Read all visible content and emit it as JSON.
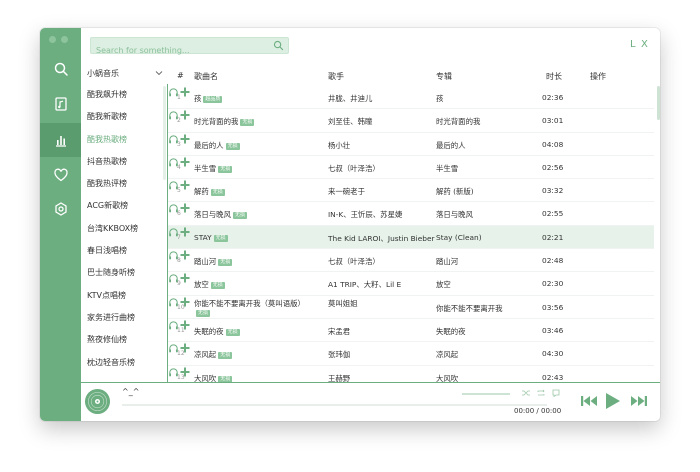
{
  "search": {
    "placeholder": "Search for something..."
  },
  "window_controls": {
    "min": "L",
    "close": "X"
  },
  "rank_select": {
    "value": "小蜗音乐"
  },
  "rank_list": [
    {
      "label": "酷我飙升榜",
      "active": false
    },
    {
      "label": "酷我新歌榜",
      "active": false
    },
    {
      "label": "酷我热歌榜",
      "active": true
    },
    {
      "label": "抖音热歌榜",
      "active": false
    },
    {
      "label": "酷我热评榜",
      "active": false
    },
    {
      "label": "ACG新歌榜",
      "active": false
    },
    {
      "label": "台湾KKBOX榜",
      "active": false
    },
    {
      "label": "春日浅唱榜",
      "active": false
    },
    {
      "label": "巴士随身听榜",
      "active": false
    },
    {
      "label": "KTV点唱榜",
      "active": false
    },
    {
      "label": "家务进行曲榜",
      "active": false
    },
    {
      "label": "熬夜修仙榜",
      "active": false
    },
    {
      "label": "枕边轻音乐榜",
      "active": false
    }
  ],
  "table": {
    "headers": {
      "index": "#",
      "title": "歌曲名",
      "singer": "歌手",
      "album": "专辑",
      "duration": "时长",
      "actions": "操作"
    },
    "rows": [
      {
        "index": "1",
        "title": "孩",
        "badge": "超品质",
        "singer": "井胧、井迪儿",
        "album": "孩",
        "duration": "02:36"
      },
      {
        "index": "2",
        "title": "时光背面的我",
        "badge": "无损",
        "singer": "刘至佳、韩瞳",
        "album": "时光背面的我",
        "duration": "03:01"
      },
      {
        "index": "3",
        "title": "最后的人",
        "badge": "无损",
        "singer": "杨小壮",
        "album": "最后的人",
        "duration": "04:08"
      },
      {
        "index": "4",
        "title": "半生雪",
        "badge": "无损",
        "singer": "七叔（叶泽浩）",
        "album": "半生雪",
        "duration": "02:56"
      },
      {
        "index": "5",
        "title": "解药",
        "badge": "无损",
        "singer": "来一碗老于",
        "album": "解药 (新版)",
        "duration": "03:32"
      },
      {
        "index": "6",
        "title": "落日与晚风",
        "badge": "无损",
        "singer": "IN-K、王忻辰、苏星婕",
        "album": "落日与晚风",
        "duration": "02:55"
      },
      {
        "index": "7",
        "title": "STAY",
        "badge": "无损",
        "singer": "The Kid LAROI、Justin Bieber",
        "album": "Stay (Clean)",
        "duration": "02:21",
        "active": true
      },
      {
        "index": "8",
        "title": "踏山河",
        "badge": "无损",
        "singer": "七叔（叶泽浩）",
        "album": "踏山河",
        "duration": "02:48"
      },
      {
        "index": "9",
        "title": "放空",
        "badge": "无损",
        "singer": "A1 TRIP、大籽、Lil E",
        "album": "放空",
        "duration": "02:30"
      },
      {
        "index": "10",
        "title": "你能不能不要离开我（莫叫语版）",
        "badge": "无损",
        "singer": "莫叫姐姐",
        "album": "你能不能不要离开我",
        "duration": "03:56"
      },
      {
        "index": "11",
        "title": "失眠的夜",
        "badge": "无损",
        "singer": "宋孟君",
        "album": "失眠的夜",
        "duration": "03:46"
      },
      {
        "index": "12",
        "title": "凉风起",
        "badge": "无损",
        "singer": "张玮伽",
        "album": "凉风起",
        "duration": "04:30"
      },
      {
        "index": "13",
        "title": "大风吹",
        "badge": "无损",
        "singer": "王赫野",
        "album": "大风吹",
        "duration": "02:43"
      }
    ]
  },
  "player": {
    "title": "^_^",
    "time_current": "00:00",
    "time_sep": "/",
    "time_total": "00:00",
    "progress": 0
  },
  "colors": {
    "accent": "#6cae80",
    "accent_dark": "#5b9c6e",
    "highlight": "#e6f2ea"
  }
}
